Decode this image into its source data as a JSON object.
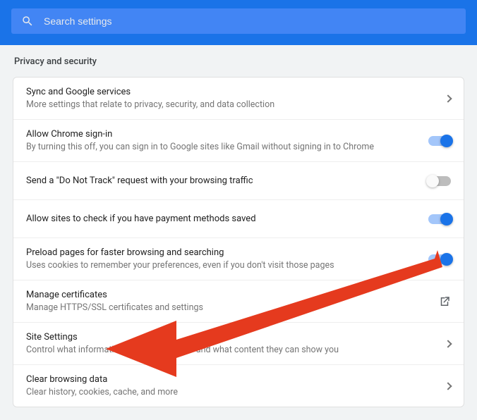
{
  "search": {
    "placeholder": "Search settings"
  },
  "section_title": "Privacy and security",
  "rows": [
    {
      "title": "Sync and Google services",
      "sub": "More settings that relate to privacy, security, and data collection",
      "action": "chevron"
    },
    {
      "title": "Allow Chrome sign-in",
      "sub": "By turning this off, you can sign in to Google sites like Gmail without signing in to Chrome",
      "action": "toggle",
      "toggle_on": true
    },
    {
      "title": "Send a \"Do Not Track\" request with your browsing traffic",
      "action": "toggle",
      "toggle_on": false
    },
    {
      "title": "Allow sites to check if you have payment methods saved",
      "action": "toggle",
      "toggle_on": true
    },
    {
      "title": "Preload pages for faster browsing and searching",
      "sub": "Uses cookies to remember your preferences, even if you don't visit those pages",
      "action": "toggle",
      "toggle_on": true
    },
    {
      "title": "Manage certificates",
      "sub": "Manage HTTPS/SSL certificates and settings",
      "action": "launch"
    },
    {
      "title": "Site Settings",
      "sub": "Control what information websites can use and what content they can show you",
      "action": "chevron"
    },
    {
      "title": "Clear browsing data",
      "sub": "Clear history, cookies, cache, and more",
      "action": "chevron"
    }
  ],
  "annotation": {
    "arrow_color": "#e53a1e"
  }
}
